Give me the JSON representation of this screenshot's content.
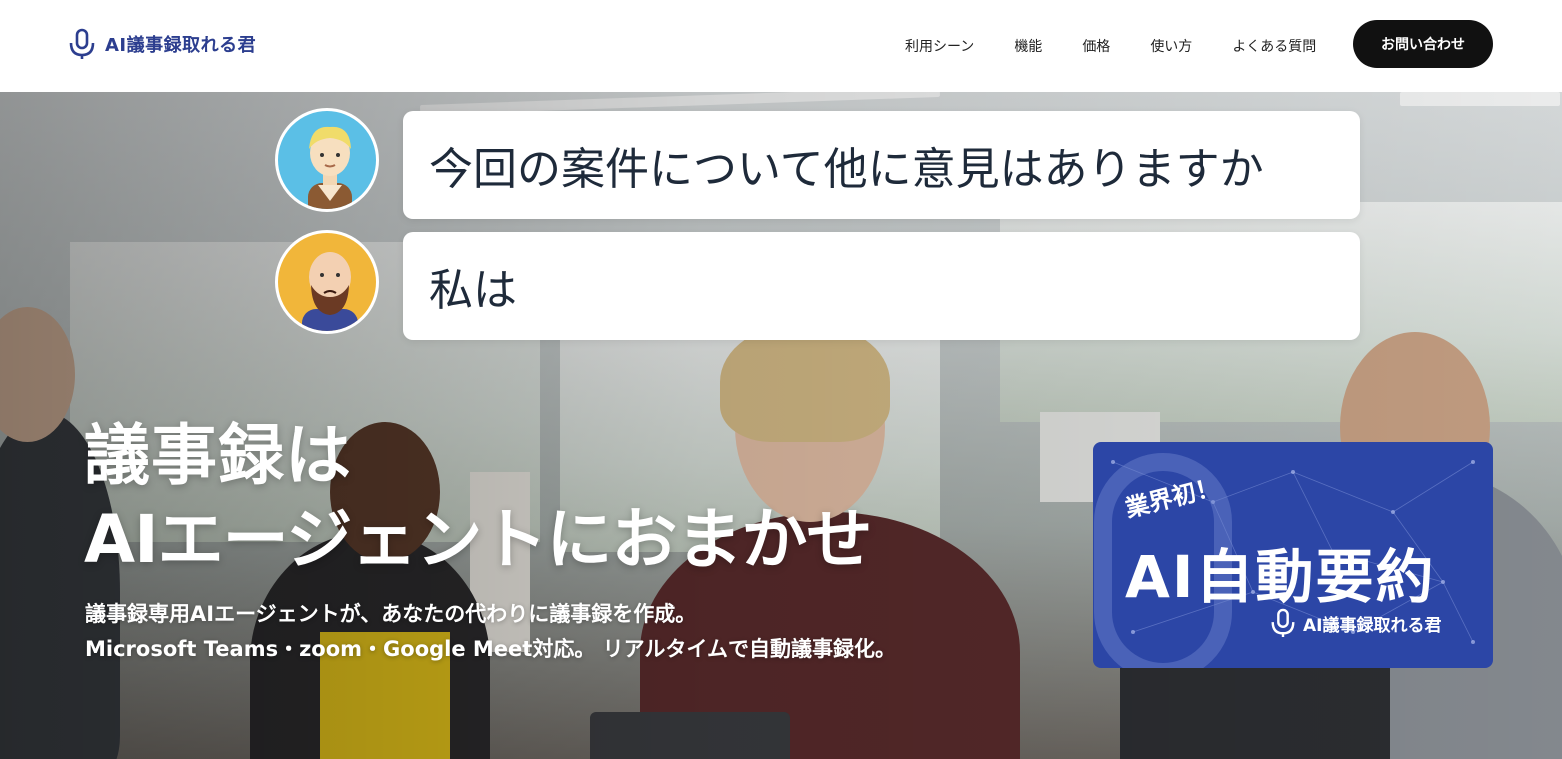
{
  "header": {
    "logo_text": "AI議事録取れる君",
    "nav": [
      {
        "label": "利用シーン"
      },
      {
        "label": "機能"
      },
      {
        "label": "価格"
      },
      {
        "label": "使い方"
      },
      {
        "label": "よくある質問"
      }
    ],
    "cta_label": "お問い合わせ"
  },
  "hero": {
    "chat": [
      {
        "text": "今回の案件について他に意見はありますか",
        "avatar": "blonde-man-avatar"
      },
      {
        "text": "私は",
        "avatar": "bearded-man-avatar"
      }
    ],
    "headline_line1": "議事録は",
    "headline_line2": "AIエージェントにおまかせ",
    "sub_line1": "議事録専用AIエージェントが、あなたの代わりに議事録を作成。",
    "sub_line2": "Microsoft Teams・zoom・Google Meet対応。 リアルタイムで自動議事録化。",
    "badge": {
      "first_label": "業界初！",
      "main_label": "AI自動要約",
      "logo_text": "AI議事録取れる君"
    }
  },
  "colors": {
    "brand": "#2c3e8f",
    "badge_bg": "#2c46a6",
    "cta_bg": "#111111"
  }
}
